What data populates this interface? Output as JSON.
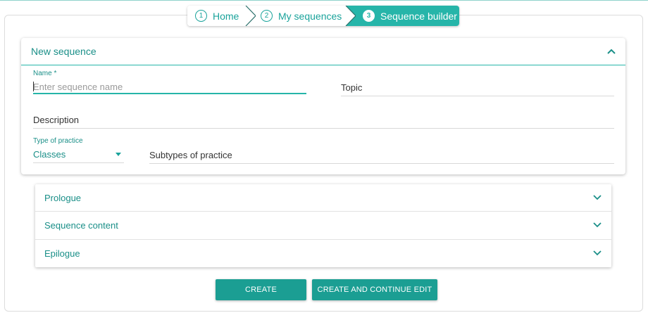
{
  "breadcrumb": {
    "steps": [
      {
        "number": "1",
        "label": "Home"
      },
      {
        "number": "2",
        "label": "My sequences"
      },
      {
        "number": "3",
        "label": "Sequence builder"
      }
    ]
  },
  "new_sequence": {
    "title": "New sequence",
    "name_label": "Name *",
    "name_placeholder": "Enter sequence name",
    "name_value": "",
    "topic_label": "Topic",
    "description_label": "Description",
    "type_label": "Type of practice",
    "type_value": "Classes",
    "subtypes_label": "Subtypes of practice"
  },
  "sections": [
    {
      "label": "Prologue"
    },
    {
      "label": "Sequence content"
    },
    {
      "label": "Epilogue"
    }
  ],
  "actions": {
    "create_label": "CREATE",
    "create_edit_label": "CREATE AND CONTINUE EDIT"
  },
  "colors": {
    "accent": "#26b5a9",
    "accent_dark": "#1b9e93",
    "text_teal": "#1a8f88"
  }
}
